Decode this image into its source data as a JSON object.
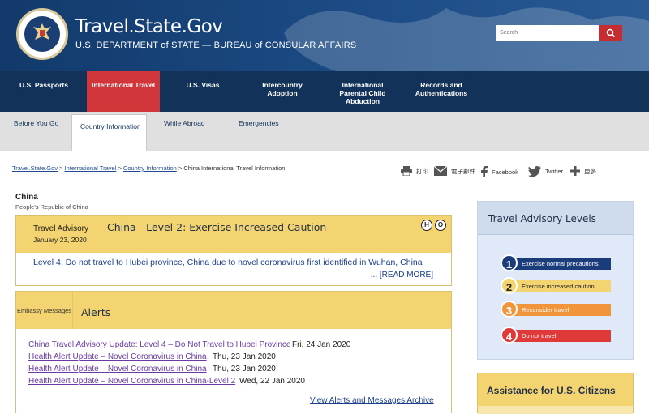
{
  "header": {
    "title": "Travel.State.Gov",
    "subtitle": "U.S. DEPARTMENT of STATE — BUREAU of CONSULAR AFFAIRS",
    "search_placeholder": "Search"
  },
  "main_nav": [
    {
      "label": "U.S. Passports"
    },
    {
      "label": "International Travel"
    },
    {
      "label": "U.S. Visas"
    },
    {
      "label": "Intercountry Adoption"
    },
    {
      "label": "International Parental Child Abduction"
    },
    {
      "label": "Records and Authentications"
    }
  ],
  "sub_nav": [
    {
      "label": "Before You Go"
    },
    {
      "label": "Country Information"
    },
    {
      "label": "While Abroad"
    },
    {
      "label": "Emergencies"
    }
  ],
  "breadcrumb": {
    "items": [
      "Travel.State.Gov",
      "International Travel",
      "Country Information"
    ],
    "separator": " > ",
    "current": "China International Travel Information"
  },
  "share": {
    "print": "打印",
    "email": "電子郵件",
    "facebook": "Facebook",
    "twitter": "Twitter",
    "more": "更多..."
  },
  "country": {
    "name": "China",
    "official_name": "People's Republic of China"
  },
  "advisory": {
    "label": "Travel Advisory",
    "date": "January 23, 2020",
    "title": "China - Level 2: Exercise Increased Caution",
    "badges": [
      "H",
      "O"
    ],
    "body": "Level 4: Do not travel to Hubei province, China due to novel coronavirus first identified in Wuhan, China",
    "read_more": "... [READ MORE]"
  },
  "alerts": {
    "tab_label": "Embassy Messages",
    "title": "Alerts",
    "items": [
      {
        "title": "China Travel Advisory Update: Level 4 – Do Not Travel to Hubei Province",
        "date": "Fri, 24 Jan 2020"
      },
      {
        "title": "Health Alert Update – Novel Coronavirus in China",
        "date": "Thu, 23 Jan 2020"
      },
      {
        "title": "Health Alert Update – Novel Coronavirus in China",
        "date": "Thu, 23 Jan 2020"
      },
      {
        "title": "Health Alert Update – Novel Coronavirus in China-Level 2",
        "date": "Wed, 22 Jan 2020"
      }
    ],
    "archive_link": "View Alerts and Messages Archive"
  },
  "levels": {
    "title": "Travel Advisory Levels",
    "items": [
      {
        "num": "1",
        "label": "Exercise normal precautions",
        "color": "#1b3c7a",
        "text_color": "#ffffff"
      },
      {
        "num": "2",
        "label": "Exercise increased caution",
        "color": "#f4d470",
        "text_color": "#222222"
      },
      {
        "num": "3",
        "label": "Reconsider travel",
        "color": "#f0953a",
        "text_color": "#ffffff"
      },
      {
        "num": "4",
        "label": "Do not travel",
        "color": "#e0393a",
        "text_color": "#ffffff"
      }
    ]
  },
  "assistance": {
    "title": "Assistance for U.S. Citizens"
  },
  "colors": {
    "nav_bg": "#123259",
    "active_tab": "#d1363a",
    "advisory_yellow": "#f4d470",
    "link_blue": "#1a3f8a",
    "visited_purple": "#6b3aa3"
  }
}
